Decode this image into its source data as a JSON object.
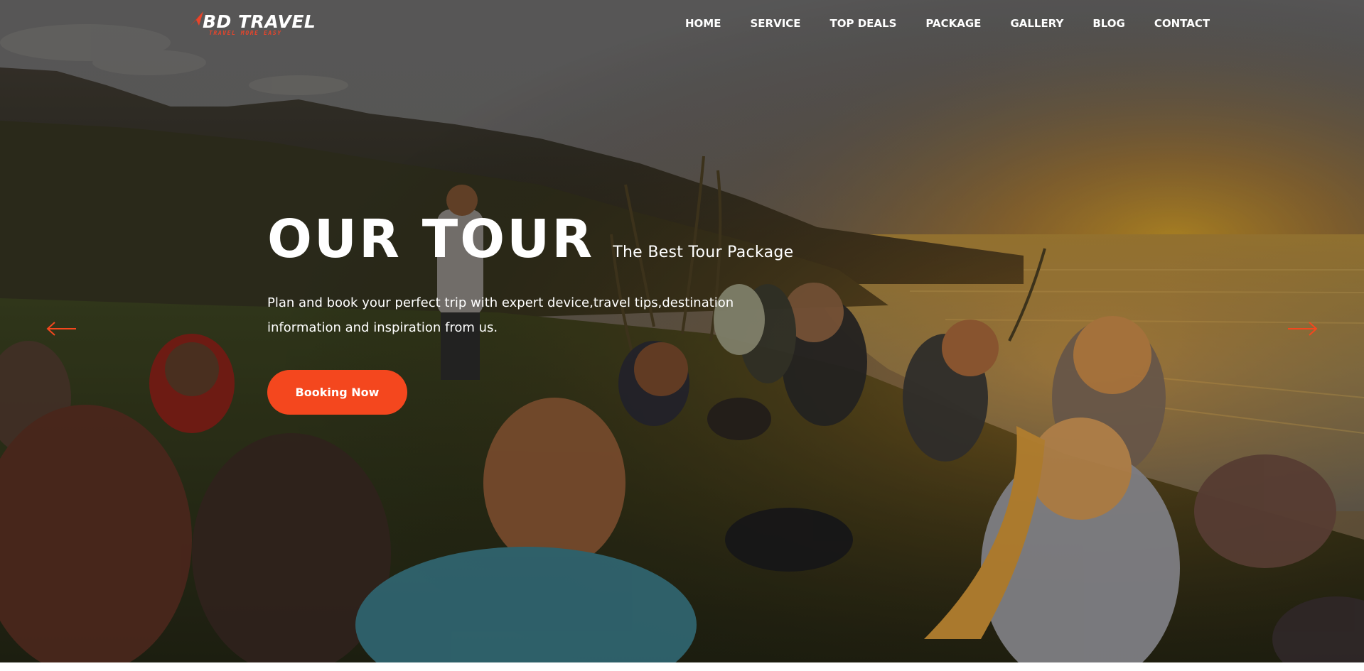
{
  "brand": {
    "name": "BD TRAVEL",
    "tagline": "TRAVEL MORE EASY",
    "accent_color": "#f4471e"
  },
  "nav": {
    "items": [
      {
        "label": "HOME"
      },
      {
        "label": "SERVICE"
      },
      {
        "label": "TOP DEALS"
      },
      {
        "label": "PACKAGE"
      },
      {
        "label": "GALLERY"
      },
      {
        "label": "BLOG"
      },
      {
        "label": "CONTACT"
      }
    ]
  },
  "hero": {
    "title": "OUR TOUR",
    "subtitle": "The Best Tour Package",
    "description": "Plan and book your perfect trip with expert device,travel tips,destination information and inspiration from us.",
    "cta_label": "Booking Now",
    "background": "group-of-friends-sitting-on-grass-at-sunset-by-the-sea",
    "prev_icon": "arrow-left-icon",
    "next_icon": "arrow-right-icon"
  }
}
